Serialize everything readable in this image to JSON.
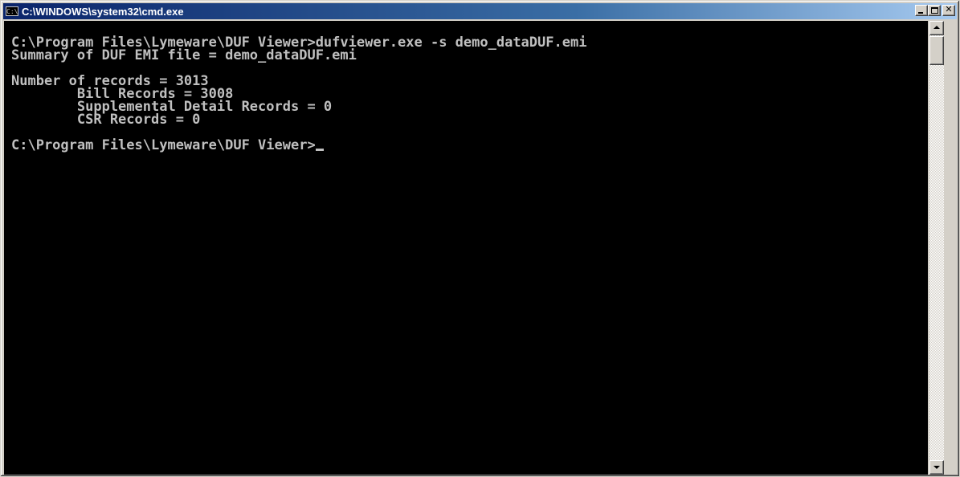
{
  "window": {
    "title": "C:\\WINDOWS\\system32\\cmd.exe",
    "icon": "cmd-icon",
    "icon_glyph": "C:\\"
  },
  "title_buttons": {
    "minimize_icon": "minimize-icon",
    "maximize_icon": "maximize-icon",
    "close_icon": "close-icon",
    "close_glyph": "✕"
  },
  "console": {
    "background": "#000000",
    "foreground": "#c0c0c0",
    "lines": [
      "C:\\Program Files\\Lymeware\\DUF Viewer>dufviewer.exe -s demo_dataDUF.emi",
      "Summary of DUF EMI file = demo_dataDUF.emi",
      "",
      "Number of records = 3013",
      "        Bill Records = 3008",
      "        Supplemental Detail Records = 0",
      "        CSR Records = 0",
      "",
      "C:\\Program Files\\Lymeware\\DUF Viewer>"
    ]
  },
  "scrollbar": {
    "up_icon": "scroll-up-arrow-icon",
    "down_icon": "scroll-down-arrow-icon",
    "position": 0
  }
}
